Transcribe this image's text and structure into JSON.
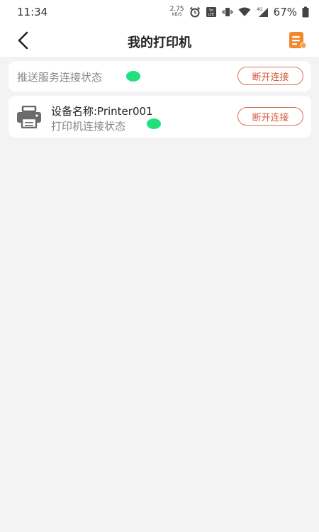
{
  "status_bar": {
    "time": "11:34",
    "net_speed_value": "2.75",
    "net_speed_unit": "KB/S",
    "battery_percent": "67%",
    "icons": [
      "alarm-icon",
      "volte-icon",
      "vibrate-icon",
      "wifi-icon",
      "signal-4g-icon",
      "battery-icon"
    ]
  },
  "header": {
    "title": "我的打印机",
    "back_icon": "chevron-left-icon",
    "right_icon": "document-list-icon",
    "accent_color": "#f08a2c"
  },
  "push_service": {
    "label": "推送服务连接状态",
    "status_color": "#1fe07a",
    "button_label": "断开连接"
  },
  "printer": {
    "icon": "printer-icon",
    "device_name": "设备名称:Printer001",
    "status_label": "打印机连接状态",
    "status_color": "#1fe07a",
    "button_label": "断开连接"
  },
  "colors": {
    "background": "#f3f3f3",
    "button_border": "#d9735a",
    "button_text": "#d35a3b"
  }
}
